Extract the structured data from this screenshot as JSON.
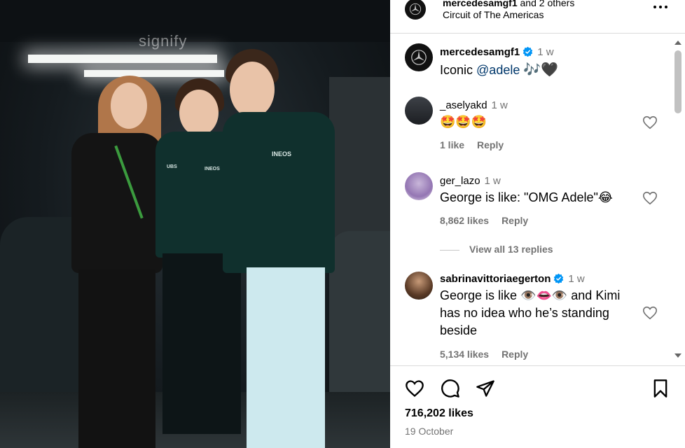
{
  "post": {
    "header": {
      "username": "mercedesamgf1",
      "coauthors_text": " and 2 others",
      "location": "Circuit of The Americas",
      "more_icon": "more-horizontal-icon"
    },
    "photo": {
      "watermark": "signify"
    },
    "caption": {
      "username": "mercedesamgf1",
      "time": "1 w",
      "text_prefix": "Iconic ",
      "mention": "@adele",
      "emojis": "🎶🖤"
    },
    "comments": [
      {
        "username": "_aselyakd",
        "time": "1 w",
        "text": "🤩🤩🤩",
        "likes": "1 like",
        "reply": "Reply"
      },
      {
        "username": "ger_lazo",
        "time": "1 w",
        "text": "George is like: \"OMG Adele\"😂",
        "likes": "8,862 likes",
        "reply": "Reply",
        "view_replies": "View all 13 replies"
      },
      {
        "username": "sabrinavittoriaegerton",
        "verified": true,
        "time": "1 w",
        "text": "George is like 👁️👄👁️ and Kimi has no idea who he’s standing beside",
        "likes": "5,134 likes",
        "reply": "Reply"
      }
    ],
    "footer": {
      "likes": "716,202 likes",
      "date": "19 October"
    },
    "colors": {
      "verified": "#0095f6",
      "mention": "#00376b",
      "secondary_text": "#737373",
      "border": "#dbdbdb"
    }
  }
}
